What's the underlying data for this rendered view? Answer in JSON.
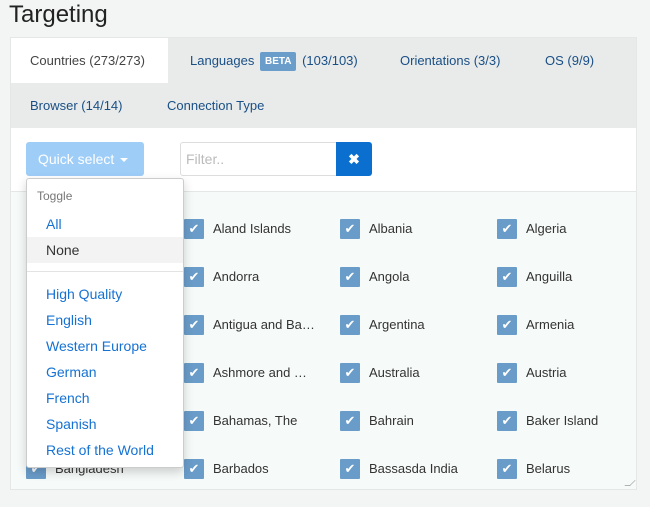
{
  "title": "Targeting",
  "tabs": [
    {
      "label": "Countries (273/273)",
      "active": true
    },
    {
      "label": "Languages",
      "badge": "BETA",
      "count": "(103/103)"
    },
    {
      "label": "Orientations (3/3)"
    },
    {
      "label": "OS (9/9)"
    },
    {
      "label": "Browser (14/14)"
    },
    {
      "label": "Connection Type"
    }
  ],
  "toolbar": {
    "quick_select": "Quick select",
    "filter_placeholder": "Filter..",
    "clear_icon": "✖"
  },
  "countries": [
    [
      "",
      "Aland Islands",
      "Albania",
      "Algeria"
    ],
    [
      "",
      "Andorra",
      "Angola",
      "Anguilla"
    ],
    [
      "",
      "Antigua and Ba…",
      "Argentina",
      "Armenia"
    ],
    [
      "",
      "Ashmore and …",
      "Australia",
      "Austria"
    ],
    [
      "",
      "Bahamas, The",
      "Bahrain",
      "Baker Island"
    ],
    [
      "Bangladesh",
      "Barbados",
      "Bassasda India",
      "Belarus"
    ]
  ],
  "menu": {
    "header": "Toggle",
    "toggle": [
      "All",
      "None"
    ],
    "presets": [
      "High Quality",
      "English",
      "Western Europe",
      "German",
      "French",
      "Spanish",
      "Rest of the World"
    ]
  },
  "colors": {
    "accent": "#0b6fcf",
    "checkbox": "#6a9cc9",
    "link": "#1572d3"
  }
}
